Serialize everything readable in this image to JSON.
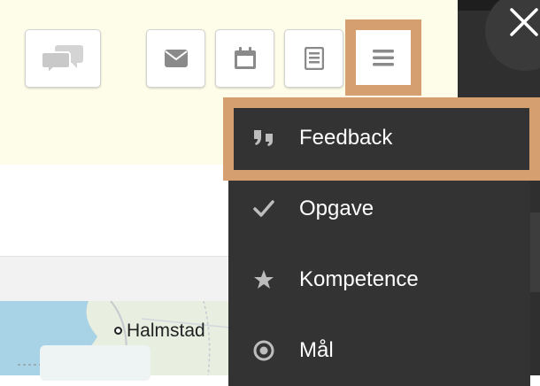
{
  "toolbar": {
    "buttons": [
      {
        "name": "chat",
        "icon": "chat-bubbles-icon"
      },
      {
        "name": "mail",
        "icon": "mail-icon"
      },
      {
        "name": "calendar",
        "icon": "calendar-icon"
      },
      {
        "name": "document",
        "icon": "document-icon"
      },
      {
        "name": "menu",
        "icon": "hamburger-menu-icon",
        "highlighted": true
      }
    ]
  },
  "overlay": {
    "close_icon": "close-icon"
  },
  "menu": {
    "items": [
      {
        "label": "Feedback",
        "icon": "quote-icon",
        "highlighted": true
      },
      {
        "label": "Opgave",
        "icon": "checkmark-icon"
      },
      {
        "label": "Kompetence",
        "icon": "star-icon"
      },
      {
        "label": "Mål",
        "icon": "target-icon"
      }
    ]
  },
  "map": {
    "place_label": "Halmstad"
  },
  "colors": {
    "panel_bg": "#fefde9",
    "highlight": "#d59f70",
    "menu_bg": "#333333",
    "icon_grey": "#8a8a8a"
  }
}
